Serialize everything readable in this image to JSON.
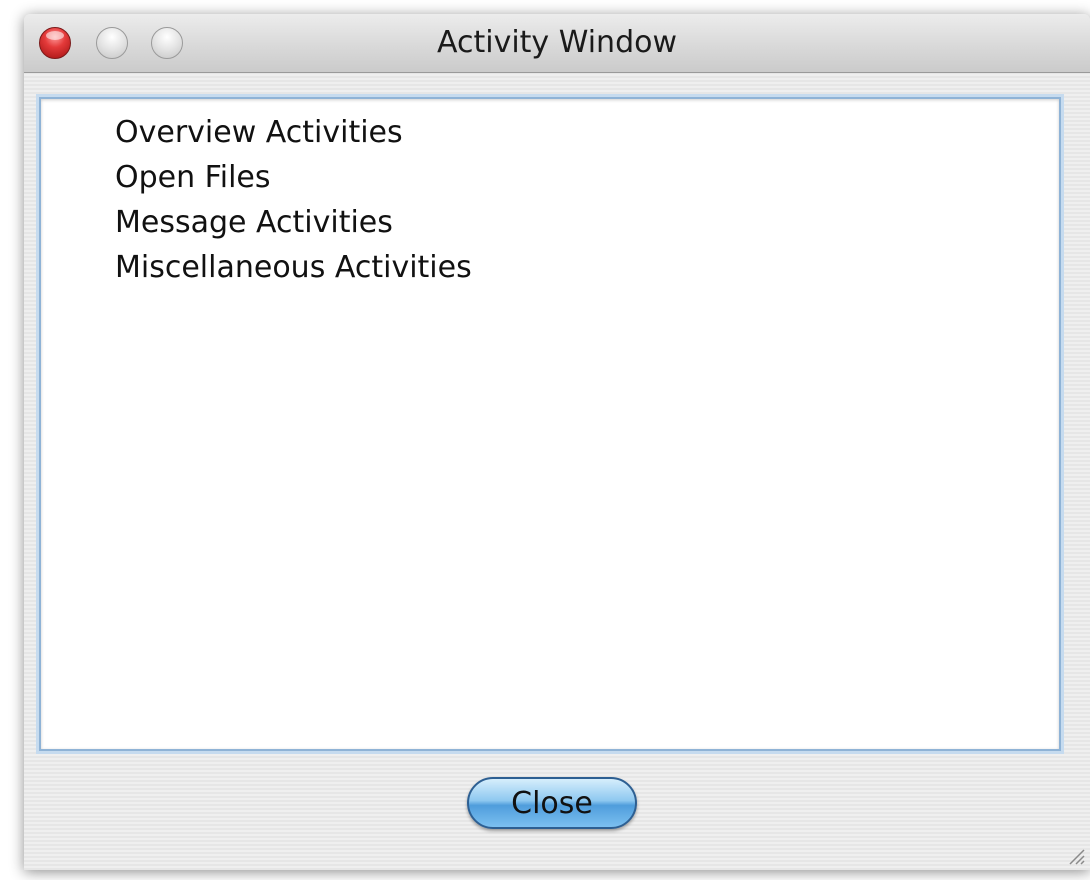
{
  "window": {
    "title": "Activity Window",
    "buttons": [
      "close-icon",
      "minimize-icon",
      "zoom-icon"
    ]
  },
  "activity_list": {
    "items": [
      {
        "label": "Overview Activities"
      },
      {
        "label": "Open Files"
      },
      {
        "label": "Message Activities"
      },
      {
        "label": "Miscellaneous Activities"
      }
    ]
  },
  "footer": {
    "close_label": "Close"
  },
  "colors": {
    "close_button_accent": "#4f9ddc",
    "list_focus_ring": "#8fb3d6",
    "traffic_close": "#e43a3a"
  }
}
